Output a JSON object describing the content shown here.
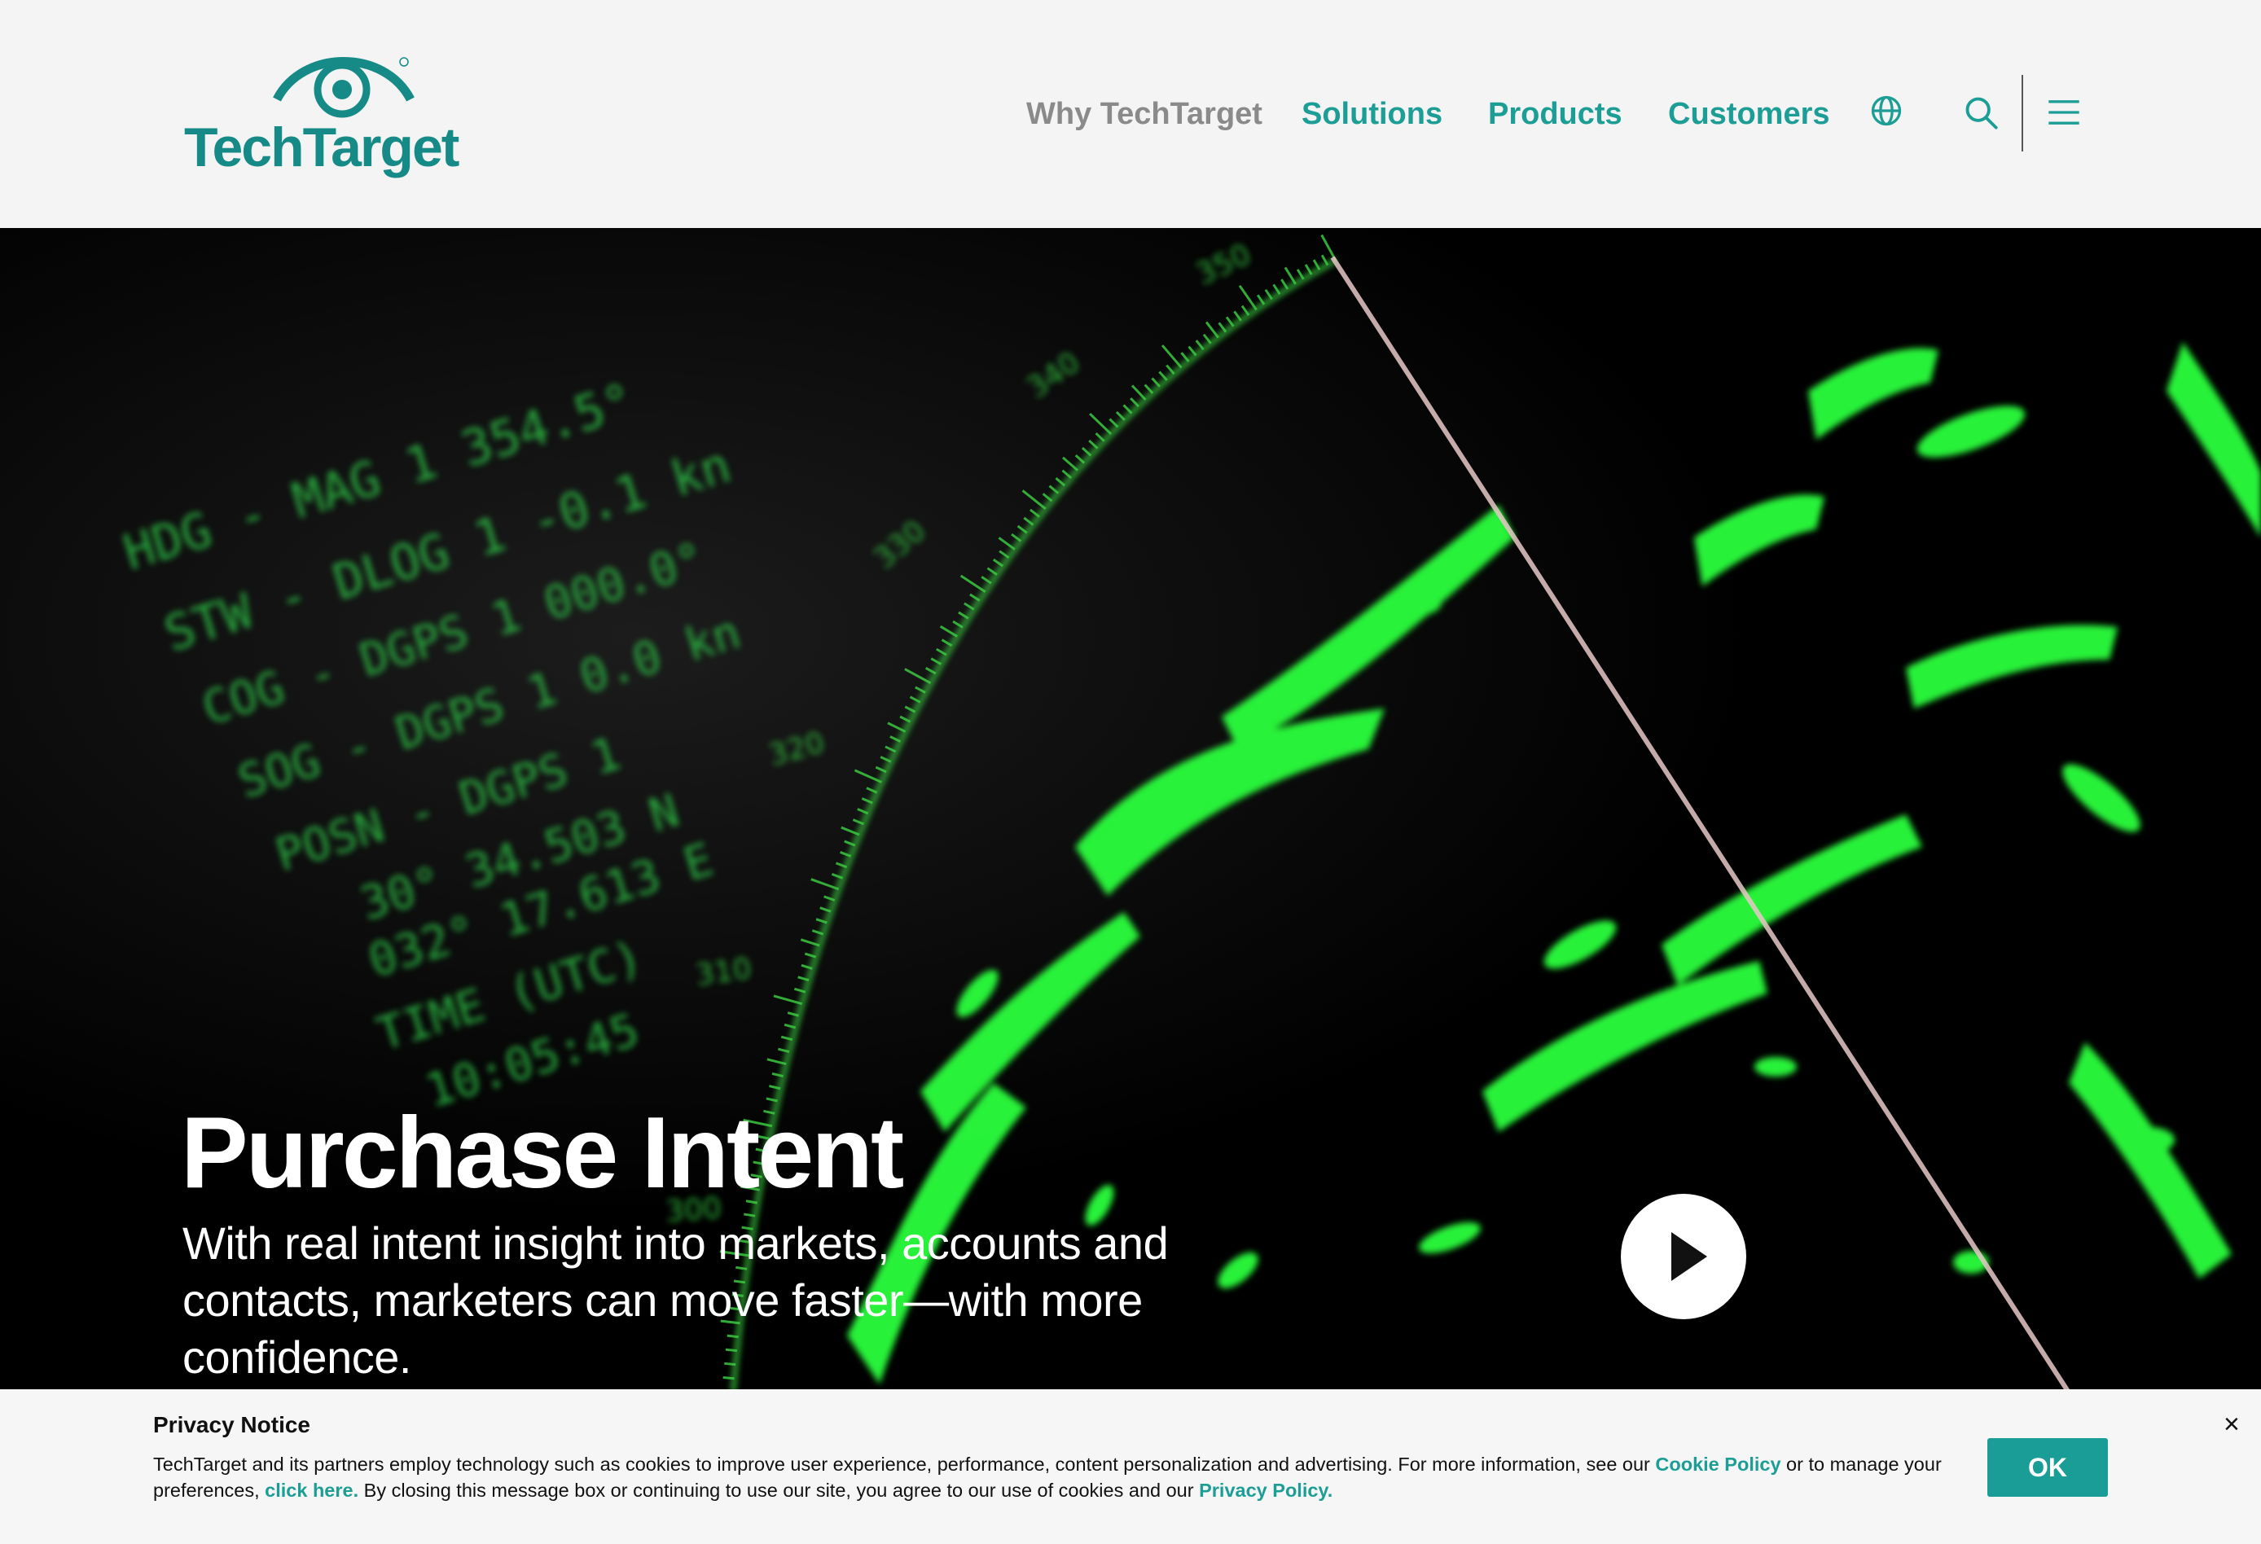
{
  "colors": {
    "brand": "#168a86",
    "nav_active": "#1c9e96",
    "nav_muted": "#8a8a8a",
    "radar_green": "#2cff3c",
    "ok_button": "#1a9d97"
  },
  "header": {
    "logo_text": "TechTarget",
    "logo_icon": "eye-icon",
    "nav": [
      {
        "label": "Why TechTarget"
      },
      {
        "label": "Solutions"
      },
      {
        "label": "Products"
      },
      {
        "label": "Customers"
      }
    ],
    "icons": [
      "globe-icon",
      "search-icon",
      "hamburger-menu-icon"
    ]
  },
  "hero": {
    "title": "Purchase Intent",
    "subtitle": "With real intent insight into markets, accounts and contacts, marketers can move faster—with more confidence.",
    "play_icon": "play-icon",
    "radar_readout": [
      {
        "label": "HDG",
        "source": "- MAG 1",
        "value": "354.5°"
      },
      {
        "label": "STW",
        "source": "- DLOG 1",
        "value": "-0.1 kn"
      },
      {
        "label": "COG",
        "source": "- DGPS 1",
        "value": "000.0°"
      },
      {
        "label": "SOG",
        "source": "- DGPS 1",
        "value": "0.0 kn"
      },
      {
        "label": "POSN",
        "source": "- DGPS 1",
        "value": ""
      }
    ],
    "radar_position": [
      "30° 34.503 N",
      "032° 17.613 E"
    ],
    "radar_time_label": "TIME (UTC)",
    "radar_time": "10:05:45",
    "radar_bearings": [
      "350",
      "340",
      "330",
      "320",
      "310",
      "300"
    ]
  },
  "privacy": {
    "title": "Privacy Notice",
    "text_1": "TechTarget and its partners employ technology such as cookies to improve user experience, performance, content personalization and advertising. For more information, see our ",
    "cookie_link": "Cookie Policy",
    "text_2": " or to manage your preferences, ",
    "click_link": "click here.",
    "text_3": " By closing this message box or continuing to use our site, you agree to our use of cookies and our ",
    "privacy_link": "Privacy Policy.",
    "ok_label": "OK",
    "close_label": "×"
  }
}
